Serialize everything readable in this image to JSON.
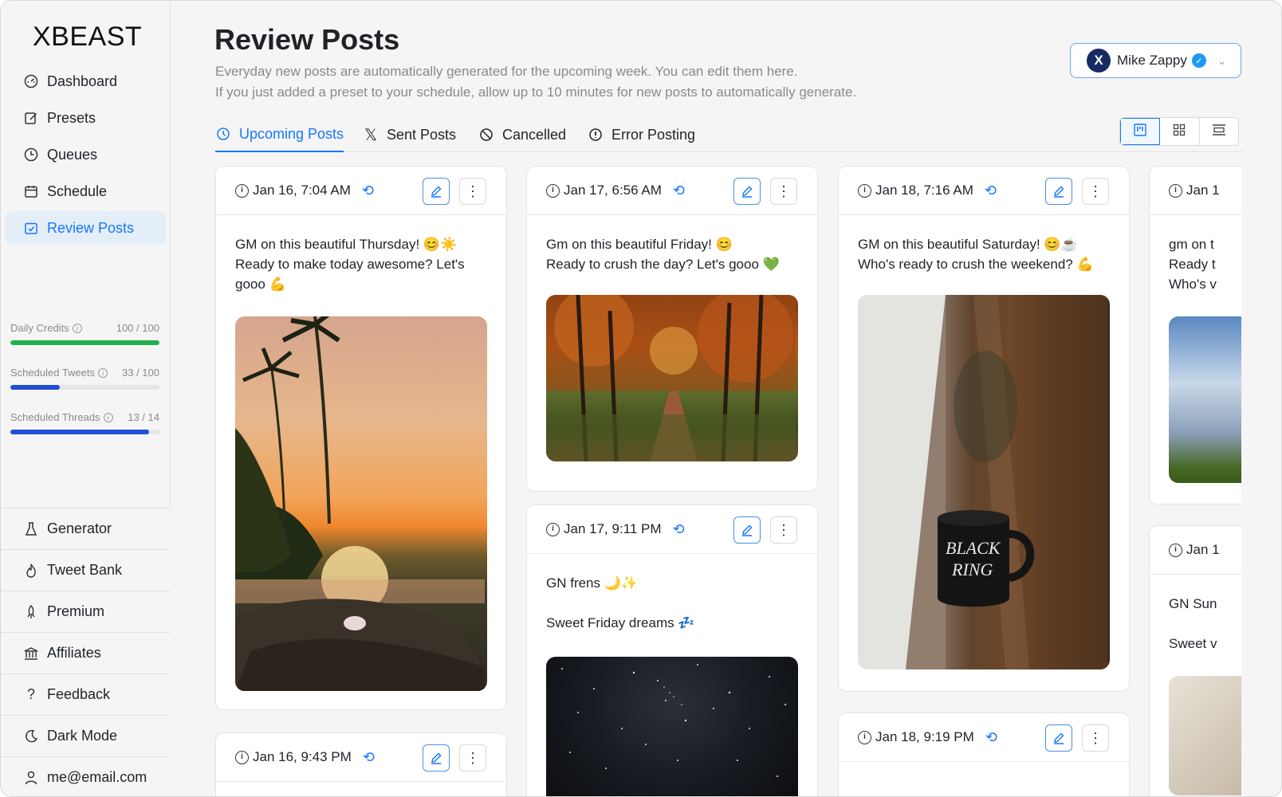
{
  "app": {
    "logo": "XBEAST"
  },
  "sidebar": {
    "nav": [
      {
        "label": "Dashboard",
        "icon": "dashboard-icon"
      },
      {
        "label": "Presets",
        "icon": "edit-square-icon"
      },
      {
        "label": "Queues",
        "icon": "clock-icon"
      },
      {
        "label": "Schedule",
        "icon": "calendar-icon"
      },
      {
        "label": "Review Posts",
        "icon": "review-check-icon",
        "active": true
      }
    ],
    "meters": [
      {
        "label": "Daily Credits",
        "value": "100 / 100",
        "fraction": 1.0,
        "color": "#22b14c"
      },
      {
        "label": "Scheduled Tweets",
        "value": "33 / 100",
        "fraction": 0.33,
        "color": "#1f4ed8"
      },
      {
        "label": "Scheduled Threads",
        "value": "13 / 14",
        "fraction": 0.93,
        "color": "#1f4ed8"
      }
    ],
    "bottom": [
      {
        "label": "Generator",
        "icon": "flask-icon"
      },
      {
        "label": "Tweet Bank",
        "icon": "flame-icon"
      },
      {
        "label": "Premium",
        "icon": "rocket-icon"
      },
      {
        "label": "Affiliates",
        "icon": "bank-icon"
      },
      {
        "label": "Feedback",
        "icon": "question-icon"
      },
      {
        "label": "Dark Mode",
        "icon": "moon-icon"
      },
      {
        "label": "me@email.com",
        "icon": "user-icon"
      }
    ]
  },
  "header": {
    "title": "Review Posts",
    "desc1": "Everyday new posts are automatically generated for the upcoming week. You can edit them here.",
    "desc2": "If you just added a preset to your schedule, allow up to 10 minutes for new posts to automatically generate.",
    "account": {
      "name": "Mike Zappy",
      "avatar": "X"
    }
  },
  "tabs": [
    {
      "label": "Upcoming Posts",
      "icon": "clock-history-icon",
      "active": true
    },
    {
      "label": "Sent Posts",
      "icon": "x-logo-icon"
    },
    {
      "label": "Cancelled",
      "icon": "cancel-icon"
    },
    {
      "label": "Error Posting",
      "icon": "error-icon"
    }
  ],
  "view_modes": [
    "kanban-view-icon",
    "grid-view-icon",
    "list-view-icon"
  ],
  "posts": {
    "c1": {
      "time": "Jan 16, 7:04 AM",
      "text": "GM on this beautiful Thursday! 😊☀️\nReady to make today awesome? Let's gooo 💪"
    },
    "c2": {
      "time": "Jan 16, 9:43 PM"
    },
    "c3": {
      "time": "Jan 17, 6:56 AM",
      "text": "Gm on this beautiful Friday! 😊\nReady to crush the day? Let's gooo 💚"
    },
    "c4": {
      "time": "Jan 17, 9:11 PM",
      "text": "GN frens 🌙✨\n\nSweet Friday dreams 💤"
    },
    "c5": {
      "time": "Jan 18, 7:16 AM",
      "text": "GM on this beautiful Saturday! 😊☕\nWho's ready to crush the weekend? 💪"
    },
    "c6": {
      "time": "Jan 18, 9:19 PM"
    },
    "c7": {
      "time": "Jan 1",
      "text": "gm on t\nReady t\nWho's v"
    },
    "c8": {
      "time": "Jan 1",
      "text": "GN Sun\n\nSweet v"
    }
  }
}
